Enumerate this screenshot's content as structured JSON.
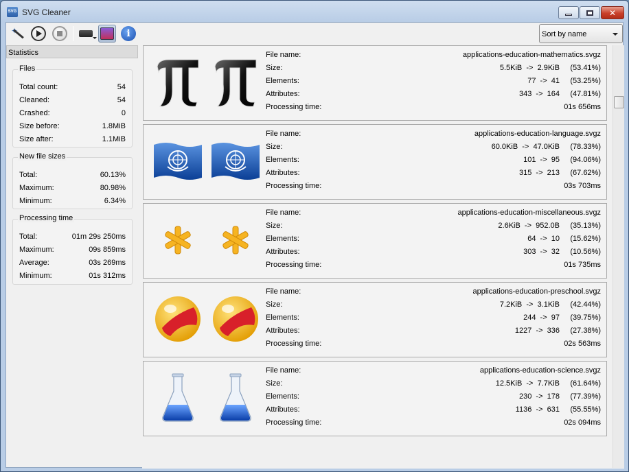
{
  "window": {
    "title": "SVG Cleaner"
  },
  "toolbar": {
    "sort_value": "Sort by name"
  },
  "statistics": {
    "header": "Statistics",
    "files": {
      "title": "Files",
      "rows": [
        {
          "label": "Total count:",
          "value": "54"
        },
        {
          "label": "Cleaned:",
          "value": "54"
        },
        {
          "label": "Crashed:",
          "value": "0"
        },
        {
          "label": "Size before:",
          "value": "1.8MiB"
        },
        {
          "label": "Size after:",
          "value": "1.1MiB"
        }
      ]
    },
    "sizes": {
      "title": "New file sizes",
      "rows": [
        {
          "label": "Total:",
          "value": "60.13%"
        },
        {
          "label": "Maximum:",
          "value": "80.98%"
        },
        {
          "label": "Minimum:",
          "value": "6.34%"
        }
      ]
    },
    "time": {
      "title": "Processing time",
      "rows": [
        {
          "label": "Total:",
          "value": "01m 29s 250ms"
        },
        {
          "label": "Maximum:",
          "value": "09s 859ms"
        },
        {
          "label": "Average:",
          "value": "03s 269ms"
        },
        {
          "label": "Minimum:",
          "value": "01s 312ms"
        }
      ]
    }
  },
  "labels": {
    "file_name": "File name:",
    "size": "Size:",
    "elements": "Elements:",
    "attributes": "Attributes:",
    "processing_time": "Processing time:"
  },
  "items": [
    {
      "icon": "pi-icon",
      "file_name": "applications-education-mathematics.svgz",
      "size": "5.5KiB  ->  2.9KiB",
      "size_pct": "(53.41%)",
      "elements": "77  ->  41",
      "elements_pct": "(53.25%)",
      "attributes": "343  ->  164",
      "attributes_pct": "(47.81%)",
      "time": "01s 656ms"
    },
    {
      "icon": "un-flag-icon",
      "file_name": "applications-education-language.svgz",
      "size": "60.0KiB  ->  47.0KiB",
      "size_pct": "(78.33%)",
      "elements": "101  ->  95",
      "elements_pct": "(94.06%)",
      "attributes": "315  ->  213",
      "attributes_pct": "(67.62%)",
      "time": "03s 703ms"
    },
    {
      "icon": "asterisk-icon",
      "file_name": "applications-education-miscellaneous.svgz",
      "size": "2.6KiB  ->  952.0B",
      "size_pct": "(35.13%)",
      "elements": "64  ->  10",
      "elements_pct": "(15.62%)",
      "attributes": "303  ->  32",
      "attributes_pct": "(10.56%)",
      "time": "01s 735ms"
    },
    {
      "icon": "beach-ball-icon",
      "file_name": "applications-education-preschool.svgz",
      "size": "7.2KiB  ->  3.1KiB",
      "size_pct": "(42.44%)",
      "elements": "244  ->  97",
      "elements_pct": "(39.75%)",
      "attributes": "1227  ->  336",
      "attributes_pct": "(27.38%)",
      "time": "02s 563ms"
    },
    {
      "icon": "flask-icon",
      "file_name": "applications-education-science.svgz",
      "size": "12.5KiB  ->  7.7KiB",
      "size_pct": "(61.64%)",
      "elements": "230  ->  178",
      "elements_pct": "(77.39%)",
      "attributes": "1136  ->  631",
      "attributes_pct": "(55.55%)",
      "time": "02s 094ms"
    }
  ]
}
